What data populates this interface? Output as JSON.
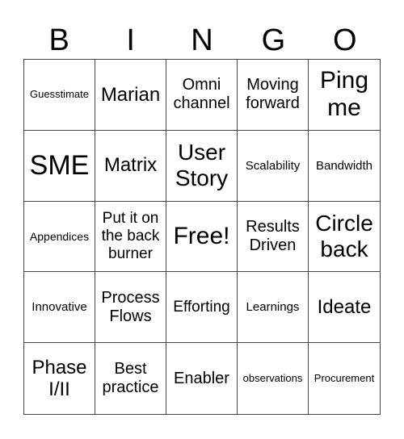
{
  "header": [
    "B",
    "I",
    "N",
    "G",
    "O"
  ],
  "cells": [
    "Guesstimate",
    "Marian",
    "Omni channel",
    "Moving forward",
    "Ping me",
    "SME",
    "Matrix",
    "User Story",
    "Scalability",
    "Bandwidth",
    "Appendices",
    "Put it on the back burner",
    "Free!",
    "Results Driven",
    "Circle back",
    "Innovative",
    "Process Flows",
    "Efforting",
    "Learnings",
    "Ideate",
    "Phase I/II",
    "Best practice",
    "Enabler",
    "observations",
    "Procurement"
  ]
}
